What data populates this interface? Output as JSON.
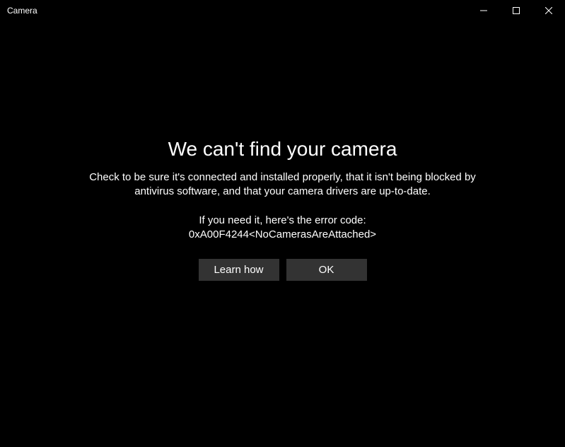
{
  "titlebar": {
    "title": "Camera"
  },
  "error": {
    "heading": "We can't find your camera",
    "description": "Check to be sure it's connected and installed properly, that it isn't being blocked by antivirus software, and that your camera drivers are up-to-date.",
    "code_intro": "If you need it, here's the error code:",
    "code": "0xA00F4244<NoCamerasAreAttached>"
  },
  "buttons": {
    "learn_how": "Learn how",
    "ok": "OK"
  }
}
